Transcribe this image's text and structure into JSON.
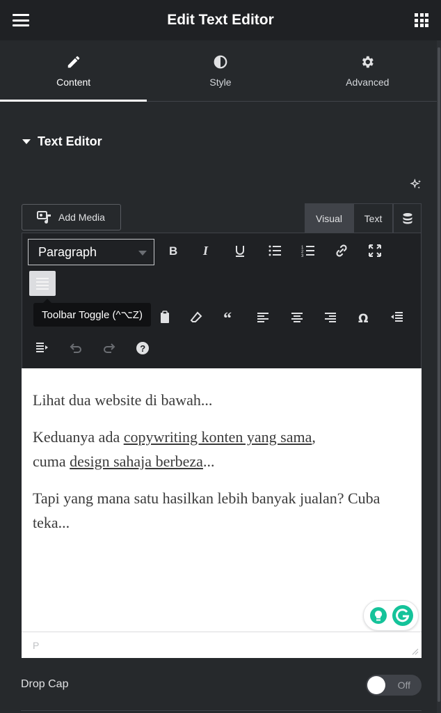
{
  "header": {
    "title": "Edit Text Editor"
  },
  "tabs": [
    {
      "label": "Content",
      "icon": "pencil-icon"
    },
    {
      "label": "Style",
      "icon": "contrast-icon"
    },
    {
      "label": "Advanced",
      "icon": "gear-icon"
    }
  ],
  "section": {
    "title": "Text Editor"
  },
  "media": {
    "add_label": "Add Media"
  },
  "mode_tabs": {
    "visual": "Visual",
    "text": "Text"
  },
  "toolbar": {
    "format_value": "Paragraph",
    "tooltip": "Toolbar Toggle (^⌥Z)"
  },
  "editor": {
    "p1": "Lihat dua website di bawah...",
    "p2_pre": "Keduanya ada ",
    "p2_link1": "copywriting konten yang sama",
    "p2_mid": ",",
    "p2_mid2": "cuma ",
    "p2_link2": "design sahaja berbeza",
    "p2_post": "...",
    "p3": "Tapi yang mana satu hasilkan lebih banyak jualan? Cuba teka...",
    "status_path": "P"
  },
  "dropcap": {
    "label": "Drop Cap",
    "state": "Off"
  }
}
